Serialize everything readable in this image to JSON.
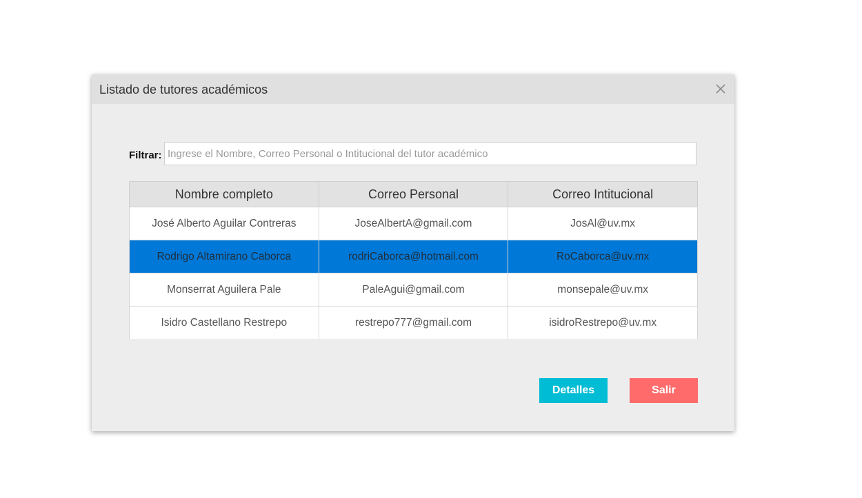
{
  "dialog": {
    "title": "Listado de tutores académicos",
    "close_icon": "close-icon"
  },
  "filter": {
    "label": "Filtrar:",
    "placeholder": "Ingrese el Nombre, Correo Personal o Intitucional del tutor académico",
    "value": ""
  },
  "table": {
    "headers": [
      "Nombre completo",
      "Correo Personal",
      "Correo Intitucional"
    ],
    "rows": [
      [
        "José Alberto Aguilar Contreras",
        "JoseAlbertA@gmail.com",
        "JosAl@uv.mx"
      ],
      [
        "Rodrigo Altamirano Caborca",
        "rodriCaborca@hotmail.com",
        "RoCaborca@uv.mx"
      ],
      [
        "Monserrat Aguilera Pale",
        "PaleAgui@gmail.com",
        "monsepale@uv.mx"
      ],
      [
        "Isidro Castellano Restrepo",
        "restrepo777@gmail.com",
        "isidroRestrepo@uv.mx"
      ]
    ],
    "selected_row": 1,
    "selected_color": "#0078d7"
  },
  "buttons": {
    "details": "Detalles",
    "exit": "Salir",
    "details_color": "#00bcd4",
    "exit_color": "#ff6b6b"
  }
}
